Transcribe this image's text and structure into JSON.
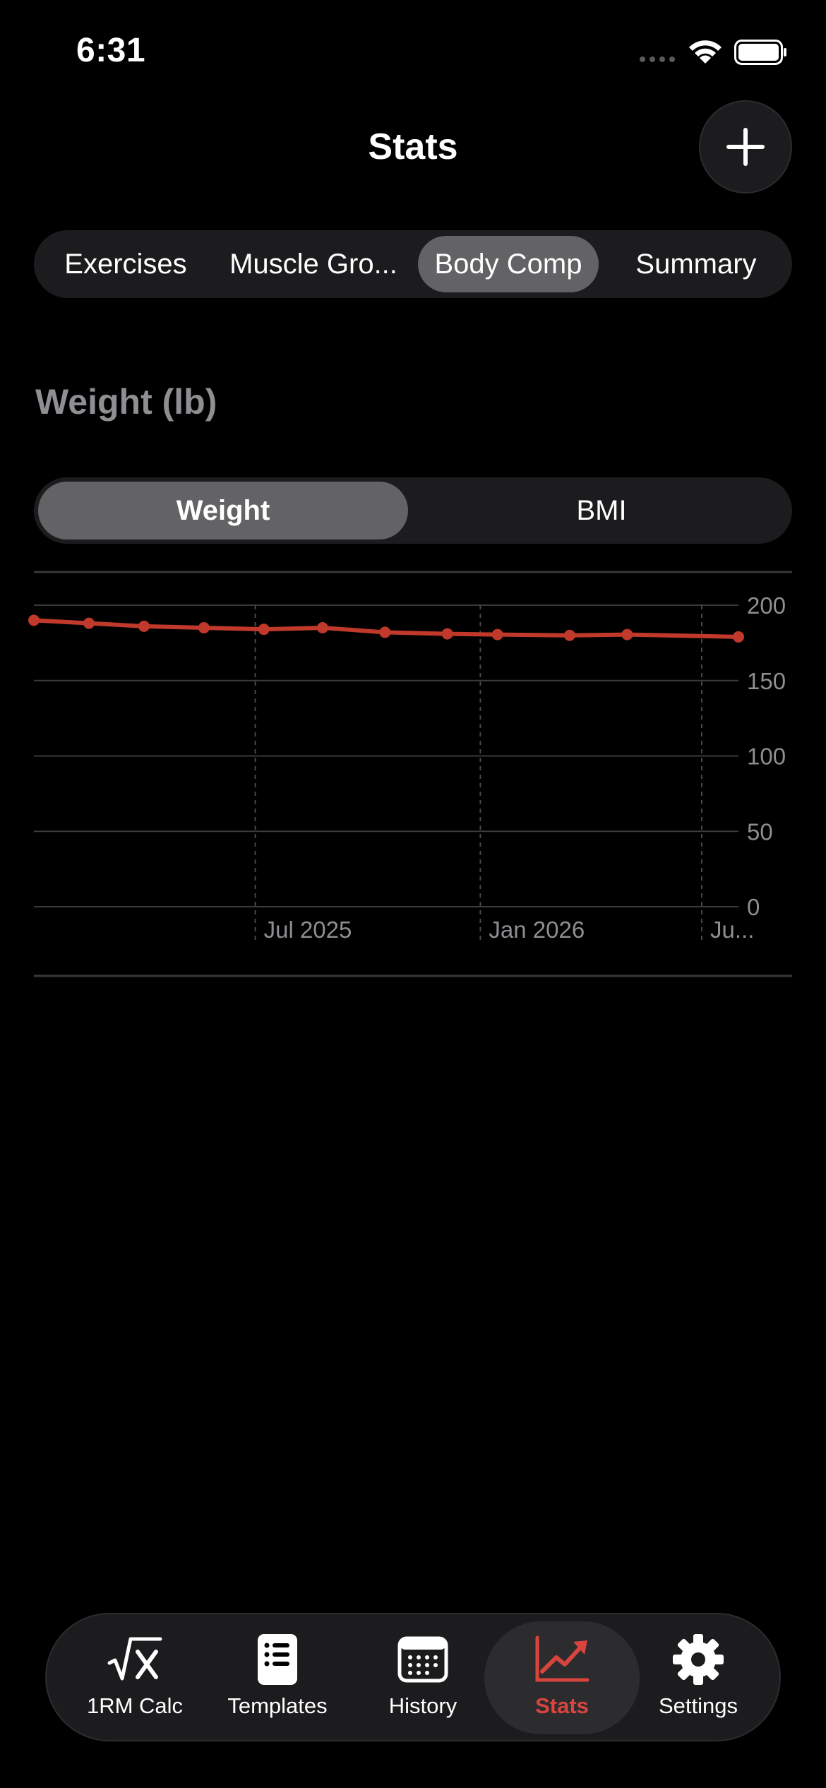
{
  "status": {
    "time": "6:31"
  },
  "header": {
    "title": "Stats"
  },
  "segments": [
    {
      "label": "Exercises",
      "active": false
    },
    {
      "label": "Muscle Gro...",
      "active": false
    },
    {
      "label": "Body Comp",
      "active": true
    },
    {
      "label": "Summary",
      "active": false
    }
  ],
  "section_title": "Weight (lb)",
  "metric_toggle": [
    {
      "label": "Weight",
      "active": true
    },
    {
      "label": "BMI",
      "active": false
    }
  ],
  "chart_data": {
    "type": "line",
    "title": "",
    "xlabel": "",
    "ylabel": "",
    "y_ticks": [
      0,
      50,
      100,
      150,
      200
    ],
    "ylim": [
      0,
      200
    ],
    "x_tick_labels": [
      "Jul 2025",
      "Jan 2026",
      "Ju..."
    ],
    "x_ticks": [
      "2025-07-01",
      "2026-01-01",
      "2026-07-01"
    ],
    "xlim": [
      "2025-01-01",
      "2026-07-31"
    ],
    "grid": true,
    "color": "#c0392b",
    "x": [
      "2025-01-01",
      "2025-02-15",
      "2025-04-01",
      "2025-05-20",
      "2025-07-08",
      "2025-08-25",
      "2025-10-15",
      "2025-12-05",
      "2026-01-15",
      "2026-03-15",
      "2026-05-01",
      "2026-07-31"
    ],
    "values": [
      190,
      188,
      186,
      185,
      184,
      185,
      182,
      181,
      180.5,
      180,
      180.5,
      179
    ]
  },
  "tabs": [
    {
      "label": "1RM Calc",
      "icon": "sqrt-x-icon",
      "active": false
    },
    {
      "label": "Templates",
      "icon": "list-clipboard-icon",
      "active": false
    },
    {
      "label": "History",
      "icon": "calendar-icon",
      "active": false
    },
    {
      "label": "Stats",
      "icon": "chart-line-up-icon",
      "active": true
    },
    {
      "label": "Settings",
      "icon": "gear-icon",
      "active": false
    }
  ],
  "colors": {
    "accent": "#d9453e",
    "line": "#c0392b",
    "surface": "#1c1c1e",
    "selected": "#636366",
    "muted": "#8e8e93"
  }
}
